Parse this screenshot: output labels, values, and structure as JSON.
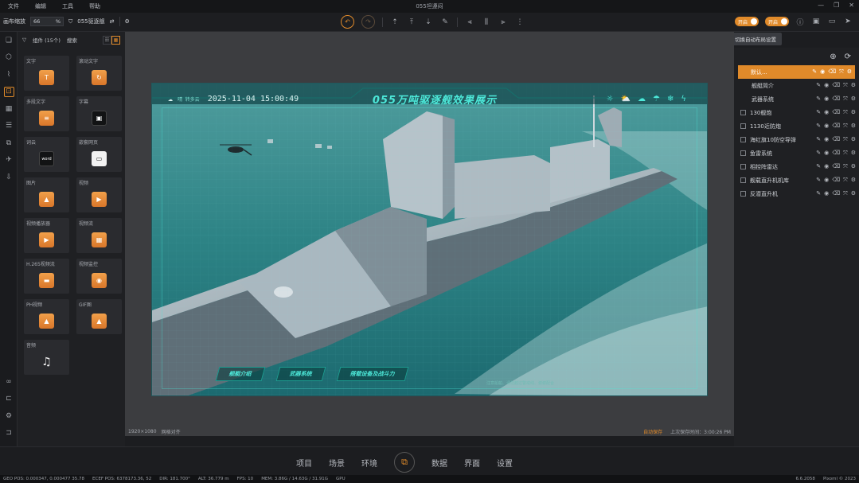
{
  "window": {
    "title": "055坦遵闷",
    "menu": [
      "文件",
      "编辑",
      "工具",
      "帮助"
    ],
    "controls": [
      "—",
      "❐",
      "✕"
    ]
  },
  "toolbar": {
    "scale_label": "画布缩放",
    "scale_value": "66",
    "scale_unit": "%",
    "filter_label": "055驱逐舰",
    "toggle_a": "开启",
    "toggle_b": "开启",
    "tooltip": "切换自动布局设置"
  },
  "rail": {
    "top_icons": [
      "file-icon",
      "cube-icon",
      "chart-icon",
      "component-icon",
      "table-icon",
      "list-icon",
      "plugin-icon",
      "drone-icon",
      "export-icon"
    ],
    "bottom_icons": [
      "link-icon",
      "layer-icon",
      "settings-icon",
      "exit-icon"
    ]
  },
  "components": {
    "header_label": "组件 (15个)",
    "search_label": "搜索",
    "items": [
      {
        "label": "文字",
        "icon": "T",
        "style": "orange"
      },
      {
        "label": "滚动文字",
        "icon": "↻",
        "style": "orange"
      },
      {
        "label": "多段文字",
        "icon": "≡",
        "style": "orange"
      },
      {
        "label": "字幕",
        "icon": "▣",
        "style": "dark"
      },
      {
        "label": "词云",
        "icon": "word",
        "style": "dark"
      },
      {
        "label": "嵌套网页",
        "icon": "▭",
        "style": "white"
      },
      {
        "label": "图片",
        "icon": "▲",
        "style": "orange"
      },
      {
        "label": "视频",
        "icon": "▶",
        "style": "orange"
      },
      {
        "label": "视频播放器",
        "icon": "▶",
        "style": "orange"
      },
      {
        "label": "视频流",
        "icon": "▦",
        "style": "orange"
      },
      {
        "label": "H.265视频流",
        "icon": "▬",
        "style": "orange"
      },
      {
        "label": "视频监控",
        "icon": "◉",
        "style": "orange"
      },
      {
        "label": "PH视频",
        "icon": "▲",
        "style": "orange"
      },
      {
        "label": "GIF图",
        "icon": "▲",
        "style": "orange"
      },
      {
        "label": "音频",
        "icon": "♫",
        "style": "music"
      }
    ]
  },
  "scene": {
    "title": "055万吨驱逐舰效果展示",
    "weather_label": "晴 转多云",
    "datetime": "2025-11-04 15:00:49",
    "weather_icons": [
      "sun-icon",
      "cloud-sun-icon",
      "cloud-icon",
      "rain-icon",
      "snow-icon",
      "storm-icon"
    ],
    "buttons": [
      "舰艇介绍",
      "武器系统",
      "搭载设备及战斗力"
    ],
    "hint": "注意船舶、请勿越过警戒线、谢谢配合"
  },
  "stage_footer": {
    "resolution": "1920×1080",
    "grid": "网格对齐",
    "status": "自动保存",
    "save_time": "上次保存时间：3:00:26 PM"
  },
  "layers": {
    "items": [
      {
        "name": "默认...",
        "selected": true,
        "child": false
      },
      {
        "name": "舰艇简介",
        "selected": false,
        "child": true
      },
      {
        "name": "武器系统",
        "selected": false,
        "child": true
      },
      {
        "name": "130舰炮",
        "selected": false,
        "child": false
      },
      {
        "name": "1130近防炮",
        "selected": false,
        "child": false
      },
      {
        "name": "海红旗10防空导弹",
        "selected": false,
        "child": false
      },
      {
        "name": "鱼雷系统",
        "selected": false,
        "child": false
      },
      {
        "name": "相控阵雷达",
        "selected": false,
        "child": false
      },
      {
        "name": "舰载直升机机库",
        "selected": false,
        "child": false
      },
      {
        "name": "反潜直升机",
        "selected": false,
        "child": false
      }
    ]
  },
  "nav": {
    "left": [
      "项目",
      "场景",
      "环境"
    ],
    "right": [
      "数据",
      "界面",
      "设置"
    ]
  },
  "status": {
    "geo": "GEO POS: 0.000347, 0.000477 35.78",
    "ecef": "ECEF POS: 6378173.36, 52",
    "dir": "DIR: 181.700°",
    "alt": "ALT: 36.779 m",
    "fps": "FPS: 10",
    "mem": "MEM: 3.86G / 14.63G / 31.91G",
    "gpu": "GPU",
    "version": "6.6.2058",
    "copyright": "Pixoml © 2023"
  }
}
